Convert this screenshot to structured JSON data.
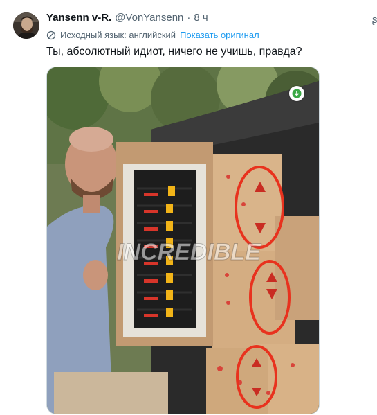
{
  "tweet": {
    "author_name": "Yansenn v-R.",
    "handle": "@VonYansenn",
    "separator": "·",
    "time": "8 ч",
    "translation_note": "Исходный язык: английский",
    "show_original_label": "Показать оригинал",
    "text": "Ты, абсолютный идиот, ничего не учишь, правда?"
  },
  "media": {
    "watermark": "INCREDIBLE"
  },
  "colors": {
    "link": "#1d9bf0",
    "secondary_text": "#536471",
    "annotation_circle": "#e8321e"
  },
  "icons": {
    "translate": "translate-icon",
    "download": "download-arrow-icon"
  }
}
